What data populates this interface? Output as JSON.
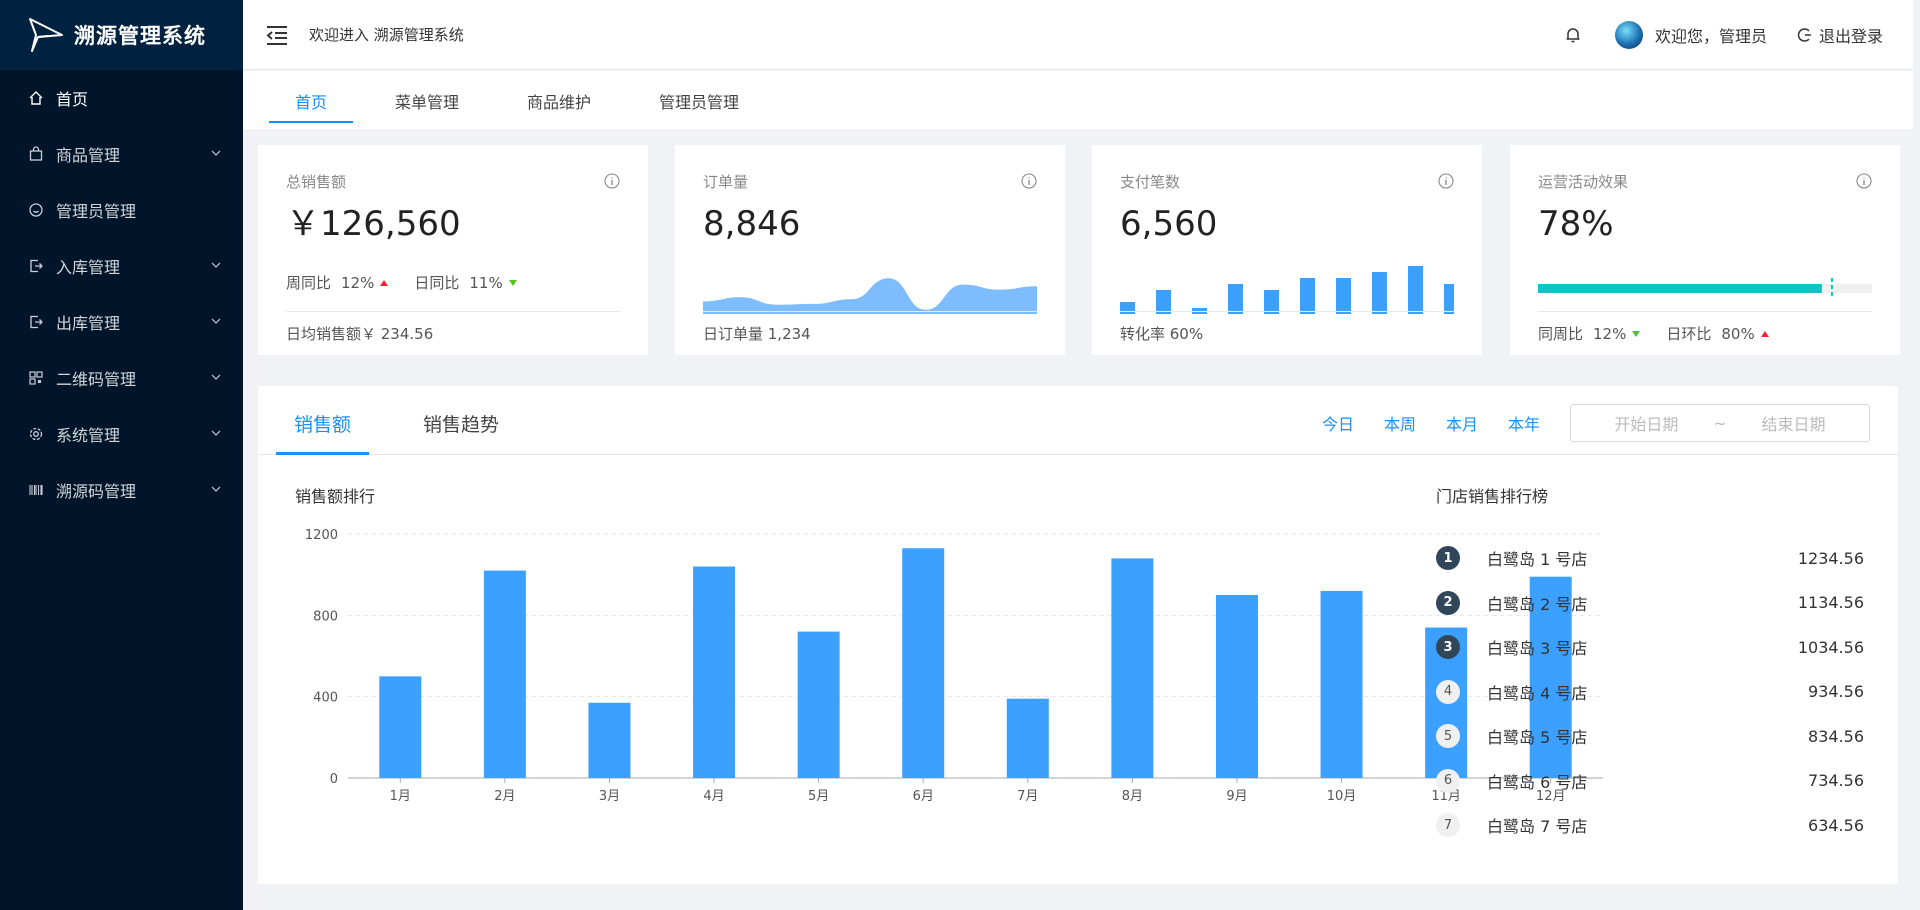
{
  "app": {
    "title": "溯源管理系统"
  },
  "sidebar": {
    "items": [
      {
        "label": "首页",
        "icon": "home-icon",
        "has_arrow": false,
        "active": true
      },
      {
        "label": "商品管理",
        "icon": "bag-icon",
        "has_arrow": true
      },
      {
        "label": "管理员管理",
        "icon": "smile-icon",
        "has_arrow": false
      },
      {
        "label": "入库管理",
        "icon": "import-icon",
        "has_arrow": true
      },
      {
        "label": "出库管理",
        "icon": "export-icon",
        "has_arrow": true
      },
      {
        "label": "二维码管理",
        "icon": "qrcode-icon",
        "has_arrow": true
      },
      {
        "label": "系统管理",
        "icon": "gear-icon",
        "has_arrow": true
      },
      {
        "label": "溯源码管理",
        "icon": "barcode-icon",
        "has_arrow": true
      }
    ]
  },
  "header": {
    "welcome": "欢迎进入 溯源管理系统",
    "user": "欢迎您，管理员",
    "logout": "退出登录"
  },
  "tabs": [
    "首页",
    "菜单管理",
    "商品维护",
    "管理员管理"
  ],
  "cards": {
    "sales": {
      "title": "总销售额",
      "value": "￥126,560",
      "wow_label": "周同比",
      "wow_value": "12%",
      "dod_label": "日同比",
      "dod_value": "11%",
      "foot": "日均销售额￥ 234.56"
    },
    "orders": {
      "title": "订单量",
      "value": "8,846",
      "foot": "日订单量 1,234"
    },
    "payments": {
      "title": "支付笔数",
      "value": "6,560",
      "foot": "转化率 60%"
    },
    "campaign": {
      "title": "运营活动效果",
      "value": "78%",
      "progress": 0.85,
      "target": 0.88,
      "wow_label": "同周比",
      "wow_value": "12%",
      "dod_label": "日环比",
      "dod_value": "80%"
    }
  },
  "colors": {
    "accent": "#1890ff",
    "bar": "#3ba0ff",
    "area": "#7cbcff",
    "progress": "#13c2c2",
    "sidebar": "#001529",
    "up": "#f5222d",
    "down": "#52c41a"
  },
  "mini_area": [
    30,
    40,
    22,
    24,
    35,
    85,
    10,
    70,
    58,
    66
  ],
  "mini_bars": [
    2,
    4,
    1,
    5,
    4,
    6,
    6,
    7,
    8,
    5
  ],
  "panel": {
    "tabs": [
      "销售额",
      "销售趋势"
    ],
    "ranges": [
      "今日",
      "本周",
      "本月",
      "本年"
    ],
    "start_placeholder": "开始日期",
    "separator": "~",
    "end_placeholder": "结束日期",
    "chart_title": "销售额排行",
    "rank_title": "门店销售排行榜"
  },
  "chart_data": {
    "type": "bar",
    "title": "销售额排行",
    "categories": [
      "1月",
      "2月",
      "3月",
      "4月",
      "5月",
      "6月",
      "7月",
      "8月",
      "9月",
      "10月",
      "11月",
      "12月"
    ],
    "values": [
      500,
      1020,
      370,
      1040,
      720,
      1130,
      390,
      1080,
      900,
      920,
      740,
      990
    ],
    "ylim": [
      0,
      1200
    ],
    "yticks": [
      0,
      400,
      800,
      1200
    ],
    "grid": true
  },
  "ranking": [
    {
      "no": "1",
      "name": "白鹭岛 1 号店",
      "value": "1234.56"
    },
    {
      "no": "2",
      "name": "白鹭岛 2 号店",
      "value": "1134.56"
    },
    {
      "no": "3",
      "name": "白鹭岛 3 号店",
      "value": "1034.56"
    },
    {
      "no": "4",
      "name": "白鹭岛 4 号店",
      "value": "934.56"
    },
    {
      "no": "5",
      "name": "白鹭岛 5 号店",
      "value": "834.56"
    },
    {
      "no": "6",
      "name": "白鹭岛 6 号店",
      "value": "734.56"
    },
    {
      "no": "7",
      "name": "白鹭岛 7 号店",
      "value": "634.56"
    }
  ]
}
